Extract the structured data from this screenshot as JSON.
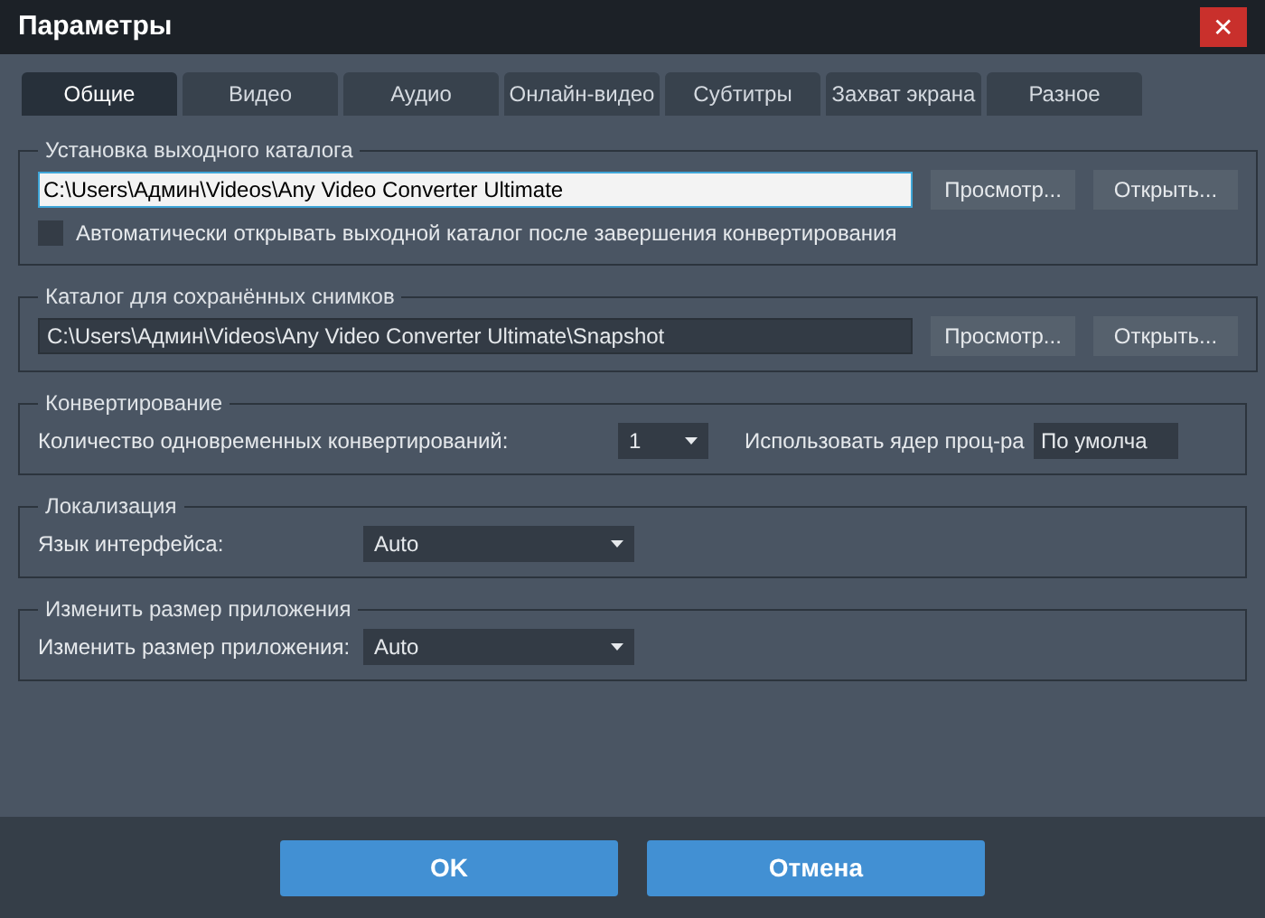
{
  "window": {
    "title": "Параметры",
    "close": "✕"
  },
  "tabs": [
    {
      "label": "Общие",
      "selected": true
    },
    {
      "label": "Видео",
      "selected": false
    },
    {
      "label": "Аудио",
      "selected": false
    },
    {
      "label": "Онлайн-видео",
      "selected": false
    },
    {
      "label": "Субтитры",
      "selected": false
    },
    {
      "label": "Захват экрана",
      "selected": false
    },
    {
      "label": "Разное",
      "selected": false
    }
  ],
  "sections": [
    {
      "title": "Установка выходного каталога",
      "rows": [
        {
          "kind": "path",
          "value": "C:\\Users\\Админ\\Videos\\Any Video Converter Ultimate",
          "focused": true,
          "buttons": [
            "Просмотр...",
            "Открыть..."
          ]
        },
        {
          "kind": "checkbox",
          "label": "Автоматически открывать выходной каталог после завершения конвертирования",
          "checked": false
        }
      ]
    },
    {
      "title": "Каталог для сохранённых снимков",
      "rows": [
        {
          "kind": "path",
          "value": "C:\\Users\\Админ\\Videos\\Any Video Converter Ultimate\\Snapshot",
          "focused": false,
          "buttons": [
            "Просмотр...",
            "Открыть..."
          ]
        }
      ]
    },
    {
      "title": "Конвертирование",
      "rows": [
        {
          "kind": "convert",
          "label": "Количество одновременных конвертирований:",
          "value": "1",
          "label2": "Использовать ядер проц-ра",
          "value2": "По умолча"
        }
      ]
    },
    {
      "title": "Локализация",
      "rows": [
        {
          "kind": "select",
          "label": "Язык интерфейса:",
          "value": "Auto"
        }
      ]
    },
    {
      "title": "Изменить размер приложения",
      "rows": [
        {
          "kind": "select",
          "label": "Изменить размер приложения:",
          "value": "Auto"
        }
      ]
    }
  ],
  "buttons": [
    "OK",
    "Отмена"
  ]
}
